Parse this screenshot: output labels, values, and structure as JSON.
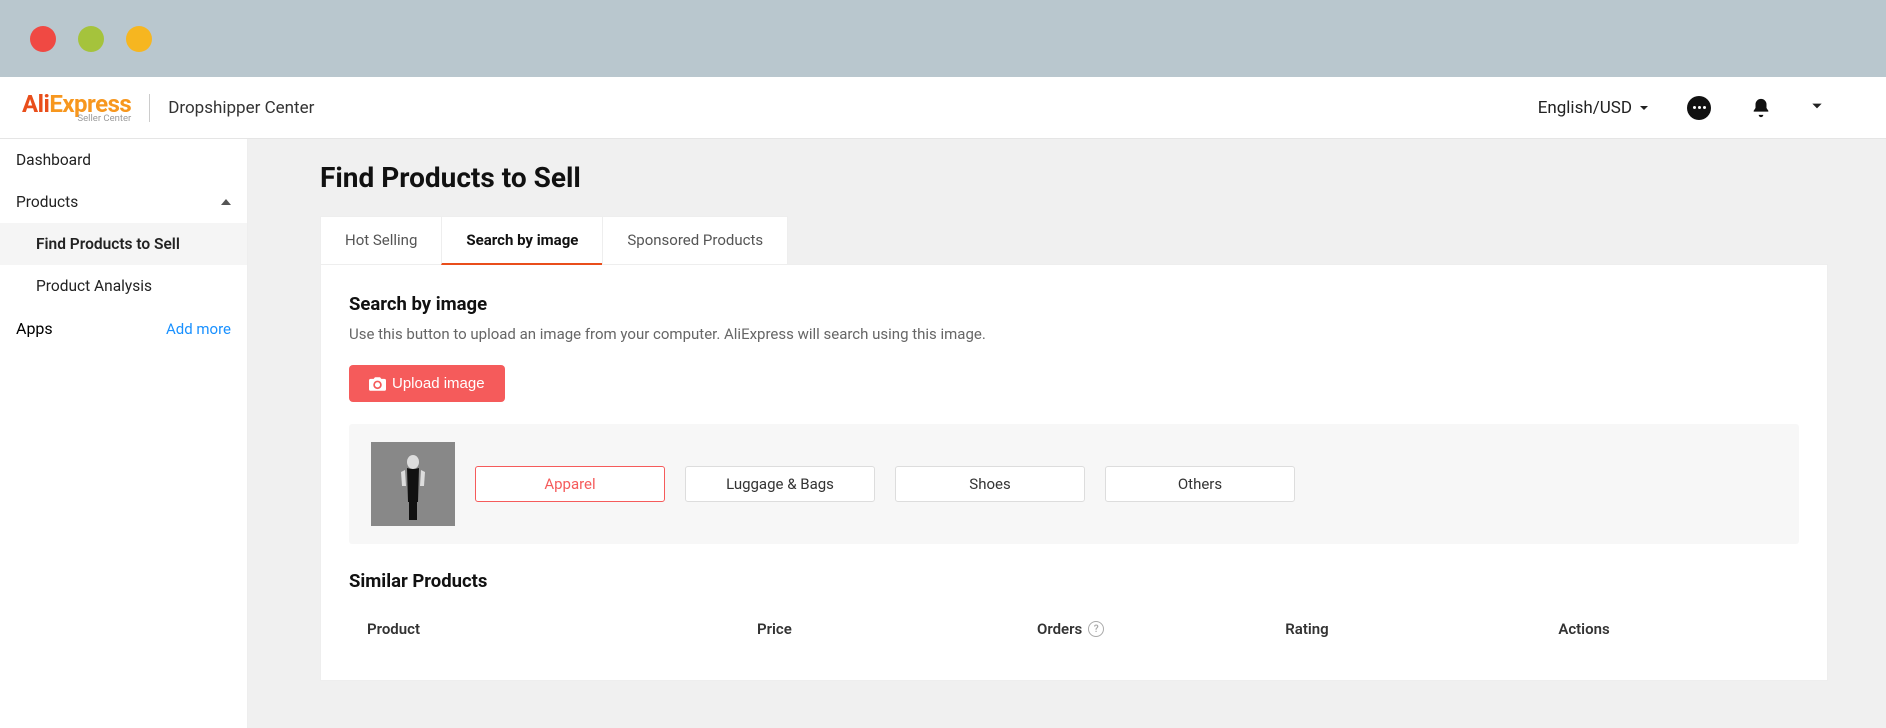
{
  "header": {
    "logo_ali": "Ali",
    "logo_express": "Express",
    "logo_sub": "Seller Center",
    "section_title": "Dropshipper Center",
    "lang_currency": "English/USD"
  },
  "sidebar": {
    "items": [
      {
        "label": "Dashboard"
      },
      {
        "label": "Products",
        "expanded": true
      },
      {
        "label": "Apps"
      }
    ],
    "products_children": [
      {
        "label": "Find Products to Sell",
        "active": true
      },
      {
        "label": "Product Analysis",
        "active": false
      }
    ],
    "add_more": "Add more"
  },
  "page": {
    "title": "Find Products to Sell",
    "tabs": [
      {
        "label": "Hot Selling",
        "active": false
      },
      {
        "label": "Search by image",
        "active": true
      },
      {
        "label": "Sponsored Products",
        "active": false
      }
    ],
    "panel": {
      "title": "Search by image",
      "description": "Use this button to upload an image from your computer. AliExpress will search using this image.",
      "upload_label": "Upload image"
    },
    "categories": [
      {
        "label": "Apparel",
        "selected": true
      },
      {
        "label": "Luggage & Bags",
        "selected": false
      },
      {
        "label": "Shoes",
        "selected": false
      },
      {
        "label": "Others",
        "selected": false
      }
    ],
    "similar": {
      "title": "Similar Products",
      "columns": {
        "product": "Product",
        "price": "Price",
        "orders": "Orders",
        "rating": "Rating",
        "actions": "Actions"
      }
    }
  }
}
